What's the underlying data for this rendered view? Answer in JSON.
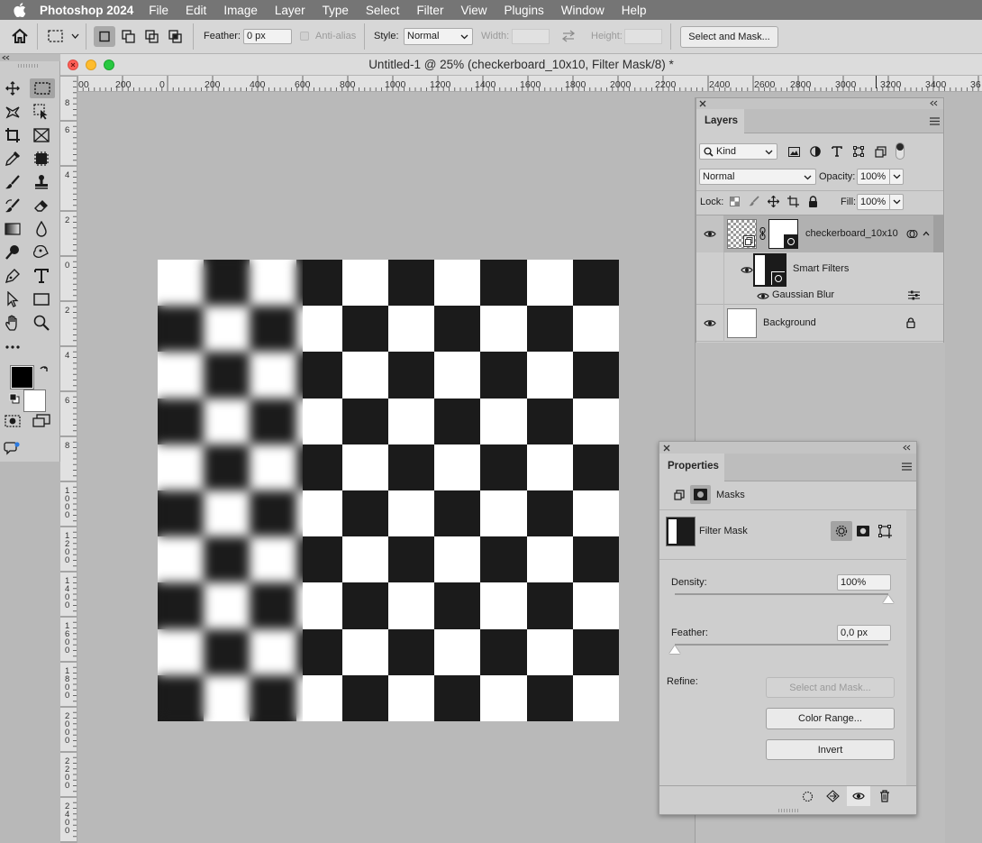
{
  "menubar": {
    "app_name": "Photoshop 2024",
    "items": [
      "File",
      "Edit",
      "Image",
      "Layer",
      "Type",
      "Select",
      "Filter",
      "View",
      "Plugins",
      "Window",
      "Help"
    ]
  },
  "options": {
    "feather_label": "Feather:",
    "feather_value": "0 px",
    "antialias_label": "Anti-alias",
    "style_label": "Style:",
    "style_value": "Normal",
    "width_label": "Width:",
    "height_label": "Height:",
    "select_mask_button": "Select and Mask..."
  },
  "document": {
    "title": "Untitled-1 @ 25% (checkerboard_10x10, Filter Mask/8) *",
    "ruler_labels": [
      "00",
      "200",
      "0",
      "200",
      "400",
      "600",
      "800",
      "1000",
      "1200",
      "1400",
      "1600",
      "1800",
      "2000",
      "2200",
      "2400",
      "2600",
      "2800",
      "3000",
      "3200",
      "3400",
      "36"
    ],
    "vruler_labels": [
      "8",
      "6",
      "4",
      "2",
      "0",
      "2",
      "4",
      "6",
      "8",
      "1\n0\n0\n0",
      "1\n2\n0\n0",
      "1\n4\n0\n0",
      "1\n6\n0\n0",
      "1\n8\n0\n0",
      "2\n0\n0\n0",
      "2\n2\n0\n0",
      "2\n4\n0\n0"
    ],
    "checkerboard": {
      "rows": 10,
      "cols": 10,
      "blurred_columns": 3.15,
      "dark_color": "#1b1b1b",
      "light_color": "#ffffff"
    }
  },
  "layers_panel": {
    "tab": "Layers",
    "filter_kind": "Kind",
    "blend_mode": "Normal",
    "opacity_label": "Opacity:",
    "opacity_value": "100%",
    "lock_label": "Lock:",
    "fill_label": "Fill:",
    "fill_value": "100%",
    "layers": [
      {
        "name": "checkerboard_10x10",
        "selected": true
      },
      {
        "name": "Smart Filters"
      },
      {
        "name": "Gaussian Blur"
      },
      {
        "name": "Background"
      }
    ]
  },
  "properties_panel": {
    "tab": "Properties",
    "section": "Masks",
    "mask_name": "Filter Mask",
    "density_label": "Density:",
    "density_value": "100%",
    "density_level": 1.0,
    "feather_label": "Feather:",
    "feather_value": "0,0 px",
    "feather_level": 0.0,
    "refine_label": "Refine:",
    "select_mask_button": "Select and Mask...",
    "color_range_button": "Color Range...",
    "invert_button": "Invert"
  },
  "colors": {
    "foreground": "#000000",
    "background": "#ffffff",
    "accent_blue": "#2a7ae2"
  }
}
